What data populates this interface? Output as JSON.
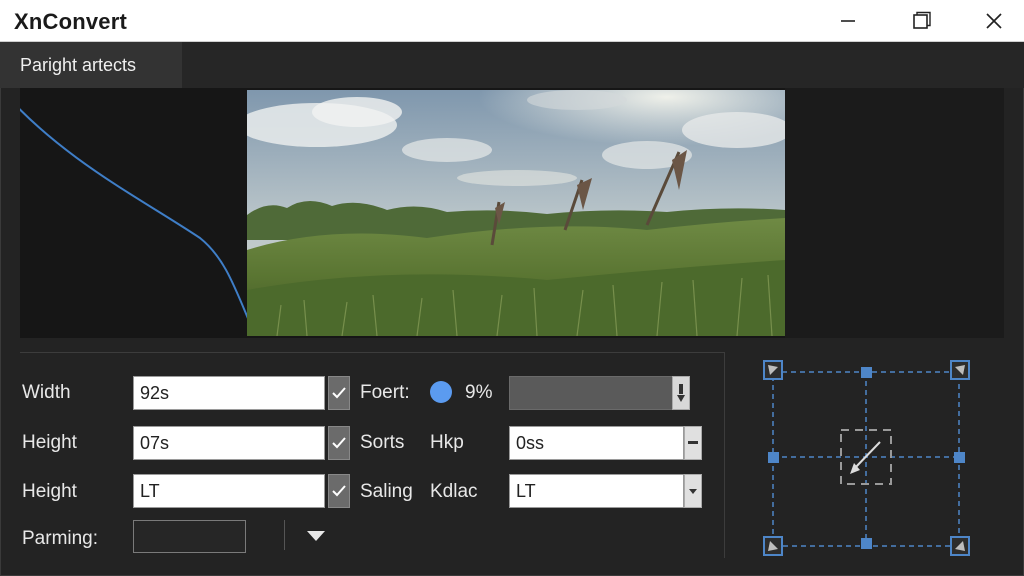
{
  "window": {
    "title": "XnConvert",
    "controls": {
      "minimize_icon": "minimize-icon",
      "maximize_icon": "maximize-icon",
      "close_icon": "close-icon"
    }
  },
  "tabs": [
    {
      "label": "Paright artects",
      "active": true
    }
  ],
  "preview": {
    "curve_color": "#3f7ec7",
    "image_description_icon": "landscape-photo"
  },
  "settings": {
    "width": {
      "label": "Width",
      "value": "92s"
    },
    "height1": {
      "label": "Height",
      "value": "07s"
    },
    "height2": {
      "label": "Height",
      "value": "LT"
    },
    "parming": {
      "label": "Parming:"
    },
    "foert": {
      "label": "Foert:",
      "value": "9%",
      "dot_color": "#5b9bf0"
    },
    "sorts": {
      "label": "Sorts",
      "sublabel": "Hkp",
      "value": "0ss"
    },
    "saling": {
      "label": "Saling",
      "sublabel": "Kdlac",
      "value": "LT"
    }
  },
  "colors": {
    "accent": "#4e86c8",
    "background": "#232323",
    "panel": "#161616"
  }
}
